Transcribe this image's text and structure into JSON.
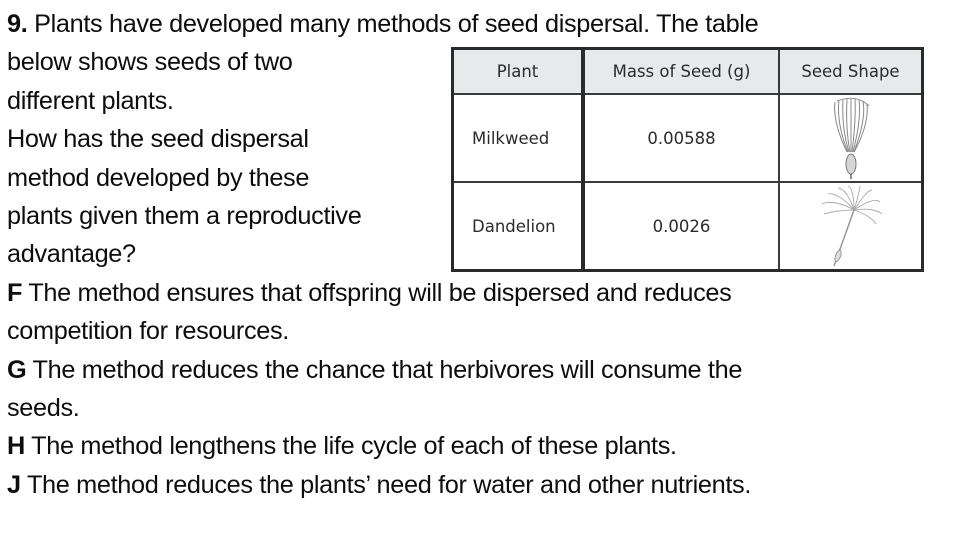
{
  "question": {
    "number": "9.",
    "lines": [
      " Plants have developed many methods of seed dispersal. The table",
      "below shows seeds of two",
      "different plants.",
      "How has the seed dispersal",
      "method developed by these",
      "plants given them a reproductive",
      "advantage?"
    ]
  },
  "table": {
    "headers": [
      "Plant",
      "Mass of Seed (g)",
      "Seed Shape"
    ],
    "rows": [
      {
        "plant": "Milkweed",
        "mass": "0.00588",
        "shape_icon": "milkweed-seed-icon"
      },
      {
        "plant": "Dandelion",
        "mass": "0.0026",
        "shape_icon": "dandelion-seed-icon"
      }
    ]
  },
  "answers": [
    {
      "letter": "F",
      "lines": [
        " The method ensures that offspring will be dispersed and reduces",
        "competition for resources."
      ]
    },
    {
      "letter": "G",
      "lines": [
        " The method reduces the chance that herbivores will consume the",
        "seeds."
      ]
    },
    {
      "letter": "H",
      "lines": [
        " The method lengthens the life cycle of each of these plants."
      ]
    },
    {
      "letter": "J",
      "lines": [
        " The method reduces the plants’ need for water and other nutrients."
      ]
    }
  ]
}
